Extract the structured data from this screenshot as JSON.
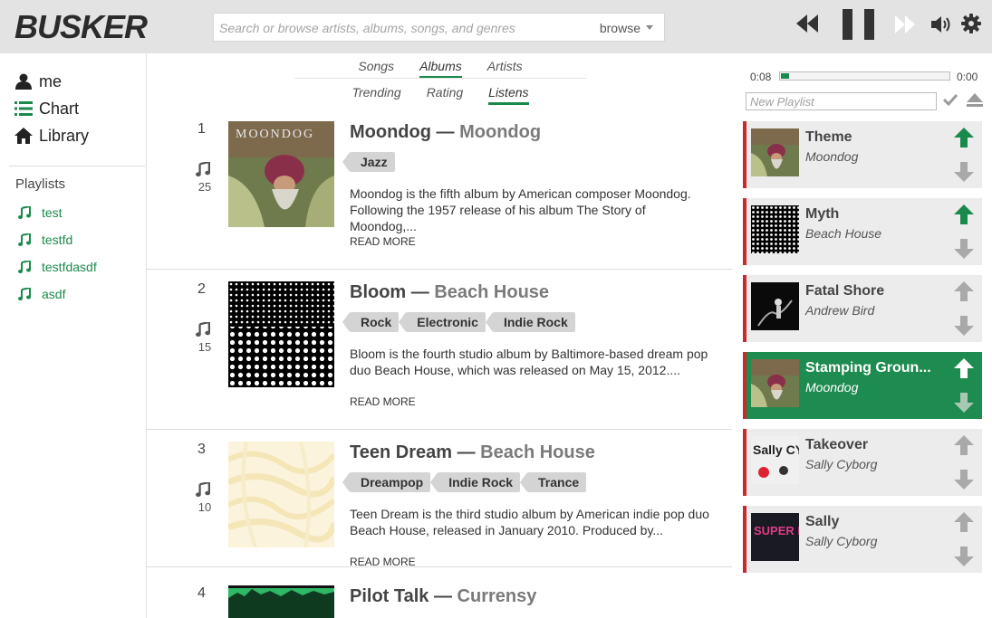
{
  "app": {
    "logo": "BUSKER"
  },
  "search": {
    "placeholder": "Search or browse artists, albums, songs, and genres",
    "browse_label": "browse"
  },
  "player": {
    "current_time": "0:08",
    "total_time": "0:00",
    "progress": 0.05
  },
  "sidebar": {
    "nav": [
      {
        "label": "me",
        "icon": "user-icon"
      },
      {
        "label": "Chart",
        "icon": "list-icon"
      },
      {
        "label": "Library",
        "icon": "home-icon"
      }
    ],
    "playlists_title": "Playlists",
    "playlists": [
      "test",
      "testfd",
      "testfdasdf",
      "asdf"
    ]
  },
  "tabs": {
    "row1": [
      "Songs",
      "Albums",
      "Artists"
    ],
    "row2": [
      "Trending",
      "Rating",
      "Listens"
    ],
    "active_row1": "Albums",
    "active_row2": "Listens"
  },
  "albums": [
    {
      "rank": "1",
      "listens": "25",
      "title": "Moondog",
      "separator": "—",
      "artist": "Moondog",
      "tags": [
        "Jazz"
      ],
      "description": "Moondog is the fifth album by American composer Moondog. Following the 1957 release of his album The Story of Moondog,...",
      "read_more": "READ MORE"
    },
    {
      "rank": "2",
      "listens": "15",
      "title": "Bloom",
      "separator": "—",
      "artist": "Beach House",
      "tags": [
        "Rock",
        "Electronic",
        "Indie Rock"
      ],
      "description": "Bloom is the fourth studio album by Baltimore-based dream pop duo Beach House, which was released on May 15, 2012....",
      "read_more": "READ MORE"
    },
    {
      "rank": "3",
      "listens": "10",
      "title": "Teen Dream",
      "separator": "—",
      "artist": "Beach House",
      "tags": [
        "Dreampop",
        "Indie Rock",
        "Trance"
      ],
      "description": "Teen Dream is the third studio album by American indie pop duo Beach House, released in January 2010. Produced by...",
      "read_more": "READ MORE"
    },
    {
      "rank": "4",
      "title": "Pilot Talk",
      "separator": "—",
      "artist": "Currensy"
    }
  ],
  "queue": {
    "new_playlist_placeholder": "New Playlist",
    "items": [
      {
        "title": "Theme",
        "artist": "Moondog",
        "playing": false
      },
      {
        "title": "Myth",
        "artist": "Beach House",
        "playing": false
      },
      {
        "title": "Fatal Shore",
        "artist": "Andrew Bird",
        "playing": false
      },
      {
        "title": "Stamping Groun...",
        "artist": "Moondog",
        "playing": true
      },
      {
        "title": "Takeover",
        "artist": "Sally Cyborg",
        "playing": false
      },
      {
        "title": "Sally",
        "artist": "Sally Cyborg",
        "playing": false
      }
    ],
    "cover_lettering": {
      "takeover": "Sally CYBORG",
      "sally": "SUPER HANDS"
    }
  },
  "colors": {
    "accent": "#1a8a4c",
    "topbar": "#e3e3e3",
    "queue_marker": "#cc2a2a",
    "playing_bg": "#1e8b50"
  }
}
